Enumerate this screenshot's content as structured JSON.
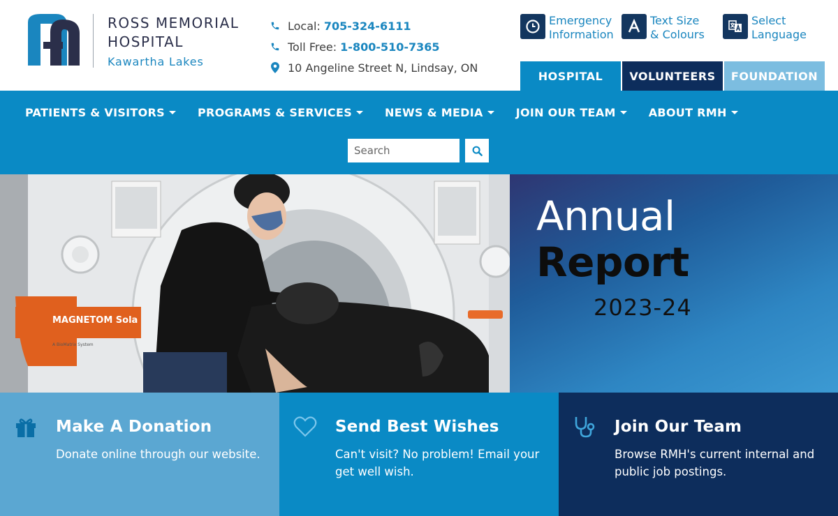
{
  "brand": {
    "name_line1": "ROSS MEMORIAL",
    "name_line2": "HOSPITAL",
    "name_line3": "Kawartha Lakes",
    "logo_icon": "rmh-logo-icon",
    "colors": {
      "primary": "#0a8ac5",
      "dark": "#0d2d5c",
      "light": "#7cbde0",
      "logo_dark": "#2b2f4a"
    }
  },
  "contact": {
    "local_label": "Local:",
    "local_value": "705-324-6111",
    "tollfree_label": "Toll Free:",
    "tollfree_value": "1-800-510-7365",
    "address": "10 Angeline Street N, Lindsay, ON"
  },
  "utility": {
    "emergency": {
      "line1": "Emergency",
      "line2": "Information",
      "icon": "clock-icon"
    },
    "text_size": {
      "line1": "Text Size",
      "line2": "& Colours",
      "icon": "letter-a-icon"
    },
    "language": {
      "line1": "Select",
      "line2": "Language",
      "icon": "translate-icon"
    }
  },
  "site_tabs": [
    "HOSPITAL",
    "VOLUNTEERS",
    "FOUNDATION"
  ],
  "nav": {
    "items": [
      "PATIENTS & VISITORS",
      "PROGRAMS & SERVICES",
      "NEWS & MEDIA",
      "JOIN OUR TEAM",
      "ABOUT RMH"
    ],
    "search_placeholder": "Search"
  },
  "hero": {
    "machine_label": "MAGNETOM Sola",
    "machine_sublabel": "A BioMatrix System",
    "banner_title": "Annual",
    "banner_subtitle": "Report",
    "banner_year": "2023-24"
  },
  "cards": [
    {
      "title": "Make A Donation",
      "text": "Donate online through our website.",
      "icon": "gift-icon"
    },
    {
      "title": "Send Best Wishes",
      "text": "Can't visit? No problem!  Email your get well wish.",
      "icon": "heart-icon"
    },
    {
      "title": "Join Our Team",
      "text": "Browse RMH's current internal and public job postings.",
      "icon": "stethoscope-icon"
    }
  ]
}
